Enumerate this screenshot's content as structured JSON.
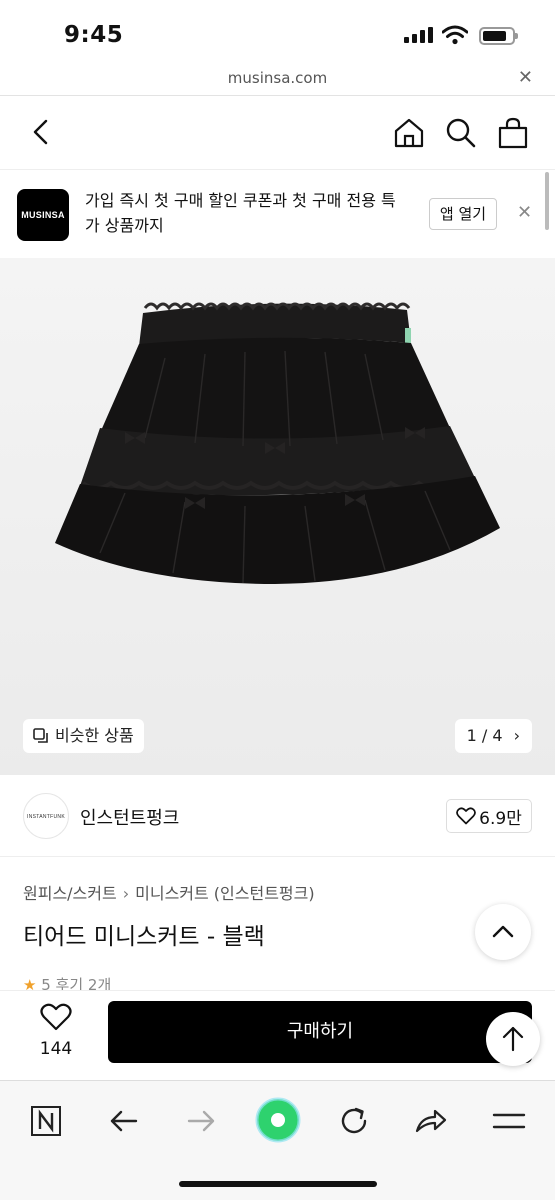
{
  "status_bar": {
    "time": "9:45"
  },
  "browser": {
    "url": "musinsa.com"
  },
  "app_banner": {
    "logo_text": "MUSINSA",
    "message": "가입 즉시 첫 구매 할인 쿠폰과 첫 구매 전용 특가 상품까지",
    "open_app_label": "앱 열기"
  },
  "product_gallery": {
    "similar_label": "비슷한 상품",
    "page_indicator": "1 / 4"
  },
  "brand": {
    "logo_text": "INSTANTFUNK",
    "name": "인스턴트펑크",
    "likes": "6.9만"
  },
  "breadcrumb": [
    "원피스/스커트",
    "미니스커트 (인스턴트펑크)"
  ],
  "product": {
    "title": "티어드 미니스커트 - 블랙",
    "rating_peek": "5  후기 2개"
  },
  "purchase_bar": {
    "wish_count": "144",
    "buy_label": "구매하기"
  },
  "icons": {
    "header": [
      "back-icon",
      "home-icon",
      "search-icon",
      "cart-icon"
    ],
    "toolbar": [
      "naver-n-icon",
      "back-arrow-icon",
      "forward-arrow-icon",
      "green-dot-icon",
      "refresh-icon",
      "share-icon",
      "menu-icon"
    ]
  },
  "colors": {
    "buy_button": "#000000",
    "toolbar_center": "#2ed26e"
  }
}
